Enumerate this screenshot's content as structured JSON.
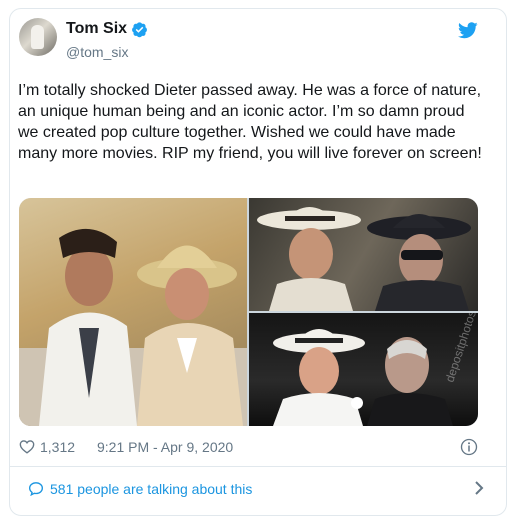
{
  "user": {
    "name": "Tom Six",
    "handle": "@tom_six"
  },
  "tweet": {
    "text": "I’m totally shocked Dieter passed away. He was a force of nature, an unique human being and an iconic actor. I’m so damn proud we created pop culture together. Wished we could have made many more movies. RIP my friend, you will live forever on screen!"
  },
  "media": {
    "watermark": "depositphotos"
  },
  "stats": {
    "likes": "1,312",
    "timestamp": "9:21 PM - Apr 9, 2020"
  },
  "conversation": {
    "label": "581 people are talking about this"
  },
  "colors": {
    "accent": "#1b95e0",
    "muted": "#657786",
    "border": "#e1e8ed"
  },
  "icons": [
    "verified-badge-icon",
    "twitter-bird-icon",
    "heart-icon",
    "info-icon",
    "speech-bubble-icon",
    "chevron-right-icon"
  ]
}
